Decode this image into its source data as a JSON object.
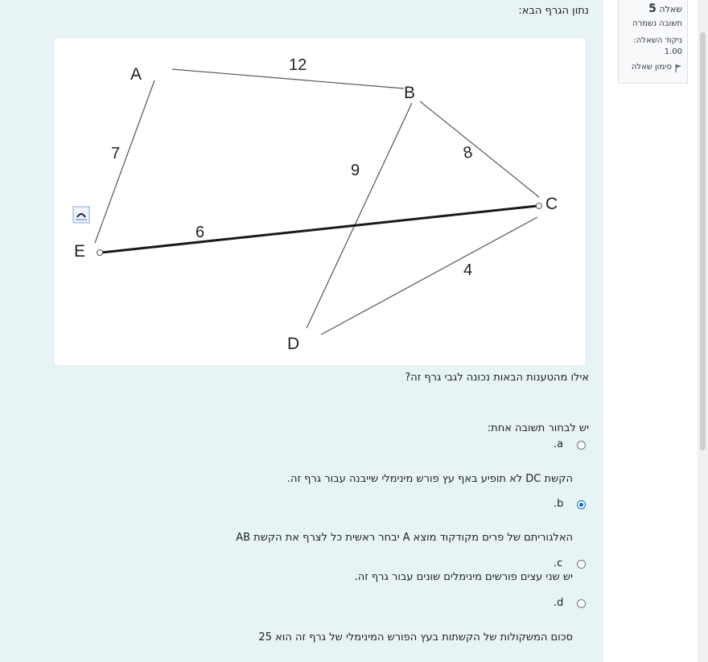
{
  "info": {
    "question_word": "שאלה",
    "question_number": "5",
    "status": "תשובה נשמרה",
    "points_label": "ניקוד השאלה:",
    "points_value": "1.00",
    "flag_label": "סימון שאלה"
  },
  "question": {
    "intro": "נתון הגרף הבא:",
    "prompt": "אילו מהטענות הבאות נכונה לגבי גרף זה?",
    "instruction": "יש לבחור תשובה אחת:"
  },
  "graph": {
    "nodes": [
      "A",
      "B",
      "C",
      "D",
      "E"
    ],
    "edges": [
      {
        "from": "A",
        "to": "B",
        "weight": "12"
      },
      {
        "from": "A",
        "to": "E",
        "weight": "7"
      },
      {
        "from": "B",
        "to": "C",
        "weight": "8"
      },
      {
        "from": "B",
        "to": "D",
        "weight": "9"
      },
      {
        "from": "E",
        "to": "C",
        "weight": "6"
      },
      {
        "from": "D",
        "to": "C",
        "weight": "4"
      }
    ]
  },
  "options": [
    {
      "letter": ".a",
      "text": "הקשת DC לא תופיע באף עץ פורש מינימלי שייבנה עבור גרף זה.",
      "selected": false
    },
    {
      "letter": ".b",
      "text": "האלגוריתם של פרים מקודקוד מוצא A יבחר ראשית כל לצרף את הקשת AB",
      "selected": true
    },
    {
      "letter": ".c",
      "text": "יש שני עצים פורשים מינימלים שונים עבור גרף זה.",
      "selected": false
    },
    {
      "letter": ".d",
      "text": "סכום המשקולות של הקשתות בעץ הפורש המינימלי של גרף זה הוא 25",
      "selected": false
    }
  ],
  "colors": {
    "panel": "#e7f3f5",
    "accent": "#0f6cbf"
  }
}
